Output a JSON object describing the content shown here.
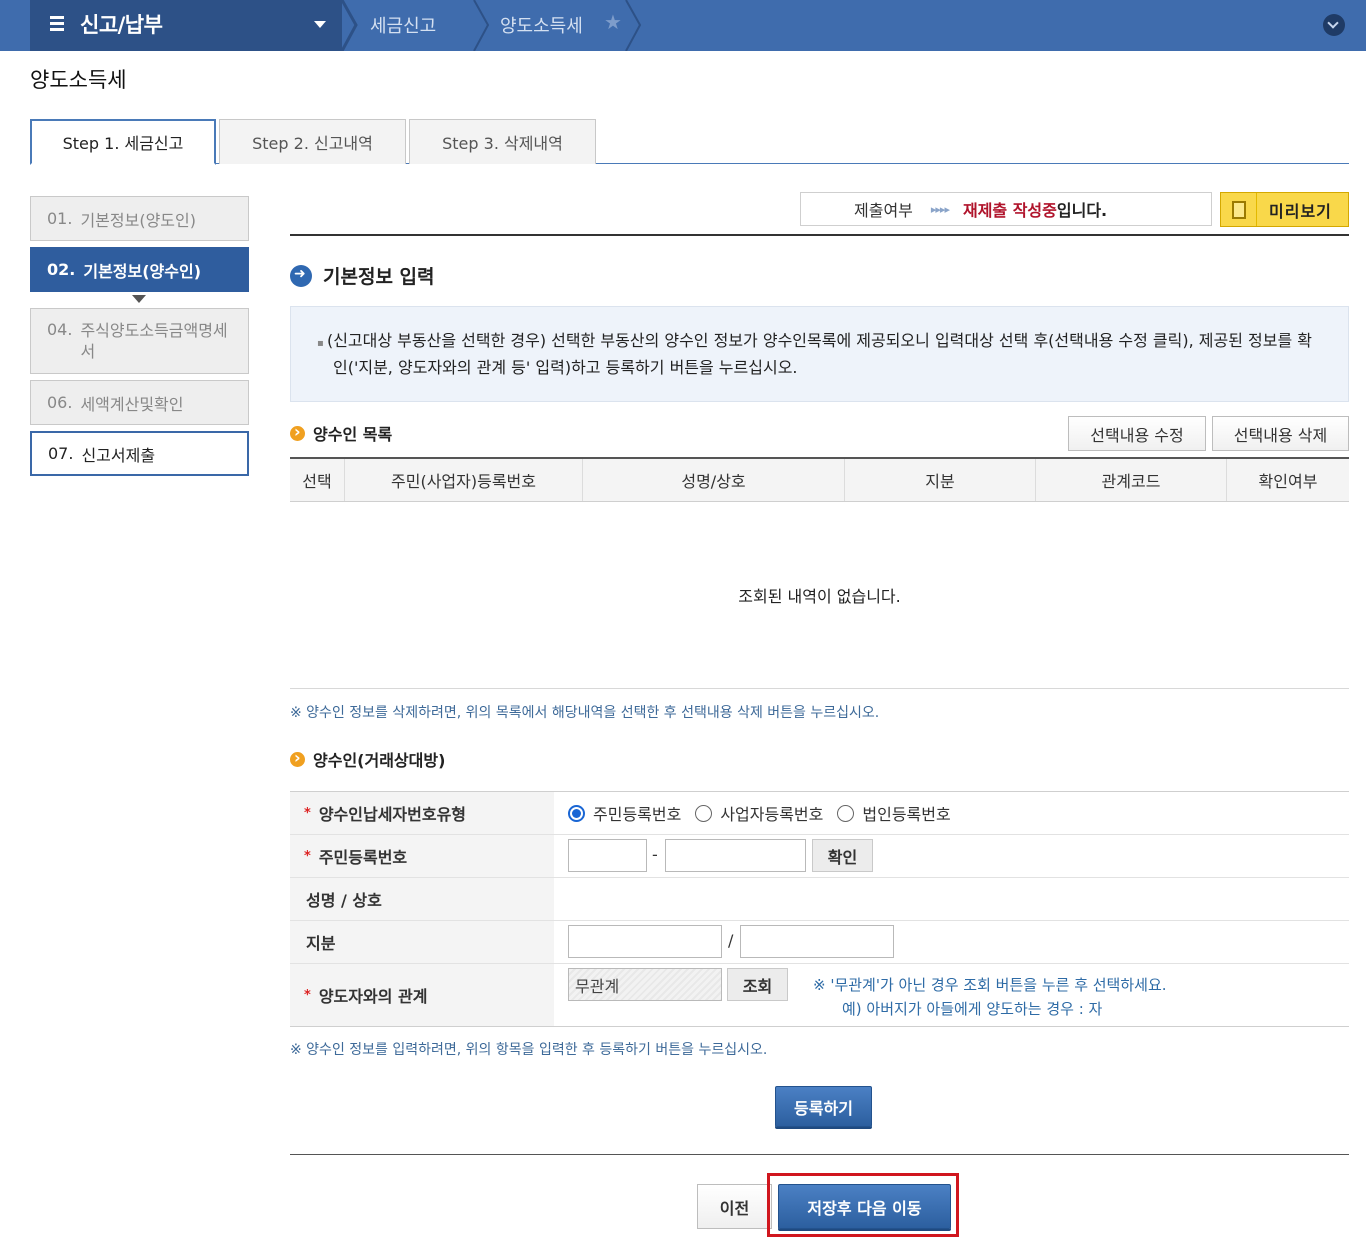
{
  "topbar": {
    "menu_title": "신고/납부",
    "crumbs": [
      "세금신고",
      "양도소득세"
    ]
  },
  "page_title": "양도소득세",
  "tabs": [
    "Step 1. 세금신고",
    "Step 2. 신고내역",
    "Step 3. 삭제내역"
  ],
  "sidenav": [
    {
      "num": "01.",
      "label": "기본정보(양도인)"
    },
    {
      "num": "02.",
      "label": "기본정보(양수인)"
    },
    {
      "num": "04.",
      "label": "주식양도소득금액명세서"
    },
    {
      "num": "06.",
      "label": "세액계산및확인"
    },
    {
      "num": "07.",
      "label": "신고서제출"
    }
  ],
  "status": {
    "label": "제출여부",
    "arrows": "▸▸▸▸",
    "value": "재제출 작성중",
    "suffix": "입니다.",
    "preview": "미리보기"
  },
  "section_title": "기본정보 입력",
  "info_text": "(신고대상 부동산을 선택한 경우) 선택한 부동산의 양수인 정보가 양수인목록에 제공되오니 입력대상 선택 후(선택내용 수정 클릭), 제공된 정보를 확인('지분, 양도자와의 관계 등' 입력)하고 등록하기 버튼을 누르십시오.",
  "list": {
    "title": "양수인 목록",
    "edit_btn": "선택내용 수정",
    "delete_btn": "선택내용 삭제",
    "columns": [
      "선택",
      "주민(사업자)등록번호",
      "성명/상호",
      "지분",
      "관계코드",
      "확인여부"
    ],
    "empty": "조회된 내역이 없습니다.",
    "note": "※ 양수인 정보를 삭제하려면, 위의 목록에서 해당내역을 선택한 후 선택내용 삭제 버튼을 누르십시오."
  },
  "form": {
    "title": "양수인(거래상대방)",
    "labels": {
      "type": "양수인납세자번호유형",
      "rrn": "주민등록번호",
      "name": "성명 / 상호",
      "share": "지분",
      "relation": "양도자와의 관계"
    },
    "radios": [
      "주민등록번호",
      "사업자등록번호",
      "법인등록번호"
    ],
    "dash": "-",
    "slash": "/",
    "confirm_btn": "확인",
    "relation_value": "무관계",
    "lookup_btn": "조회",
    "hint1": "※ '무관계'가 아닌 경우 조회 버튼을 누른 후 선택하세요.",
    "hint2": "예) 아버지가 아들에게 양도하는 경우 : 자",
    "note": "※ 양수인 정보를 입력하려면, 위의 항목을 입력한 후 등록하기 버튼을 누르십시오."
  },
  "buttons": {
    "register": "등록하기",
    "prev": "이전",
    "save_next": "저장후 다음 이동"
  }
}
